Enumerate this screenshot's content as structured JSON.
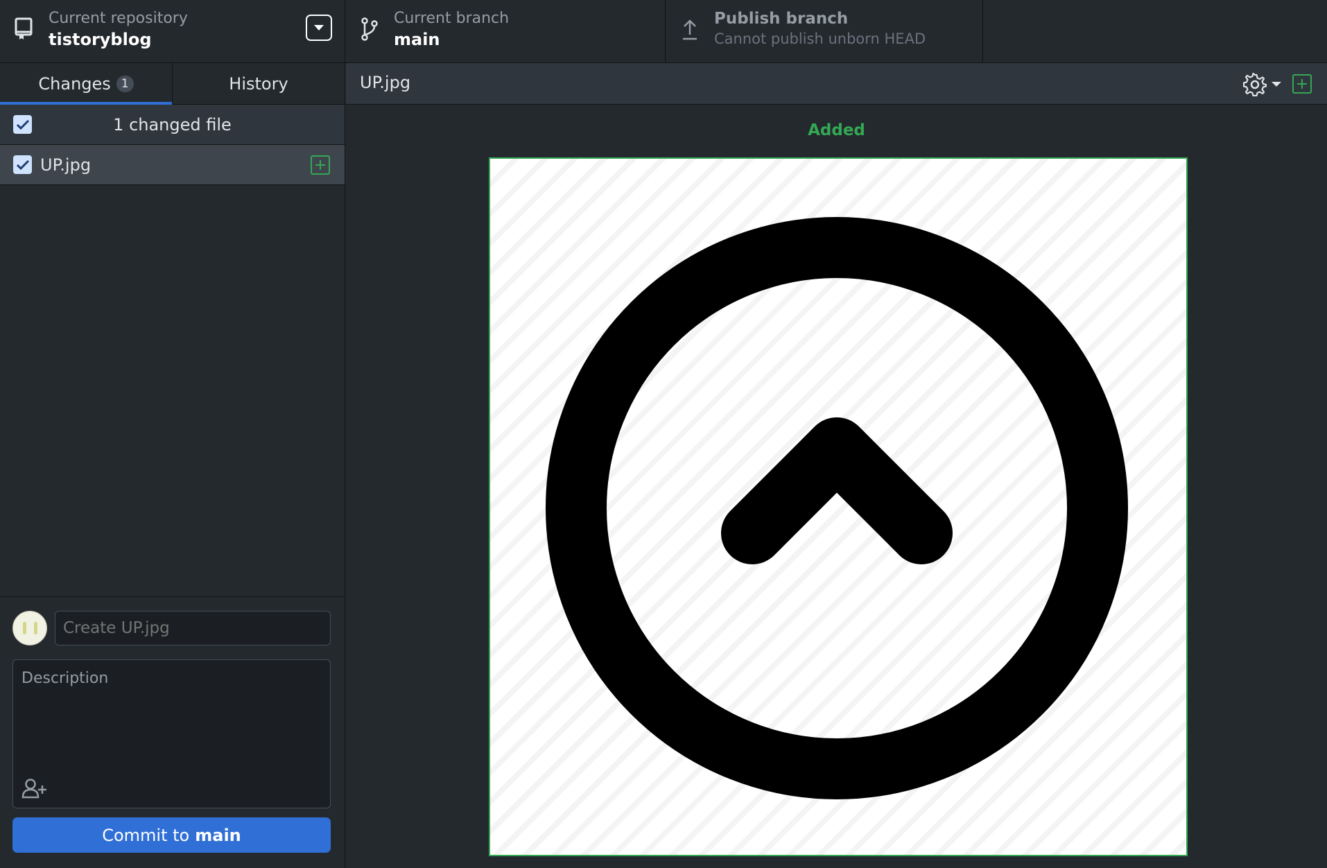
{
  "toolbar": {
    "repo": {
      "label": "Current repository",
      "value": "tistoryblog"
    },
    "branch": {
      "label": "Current branch",
      "value": "main"
    },
    "publish": {
      "label": "Publish branch",
      "sub": "Cannot publish unborn HEAD"
    }
  },
  "sidebar": {
    "tabs": [
      {
        "label": "Changes",
        "badge": "1"
      },
      {
        "label": "History"
      }
    ],
    "changes_header": "1 changed file",
    "files": [
      {
        "name": "UP.jpg",
        "status": "added"
      }
    ]
  },
  "commit": {
    "summary_placeholder": "Create UP.jpg",
    "description_placeholder": "Description",
    "button_prefix": "Commit to",
    "button_branch": "main"
  },
  "main": {
    "path": "UP.jpg",
    "diff_label": "Added"
  },
  "colors": {
    "accent": "#2f6fd6",
    "added": "#34a853",
    "background": "#24292e"
  },
  "icons": [
    "repo-icon",
    "branch-icon",
    "upload-icon",
    "dropdown-icon",
    "checkbox-icon",
    "file-added-icon",
    "gear-icon",
    "coauthor-icon"
  ]
}
